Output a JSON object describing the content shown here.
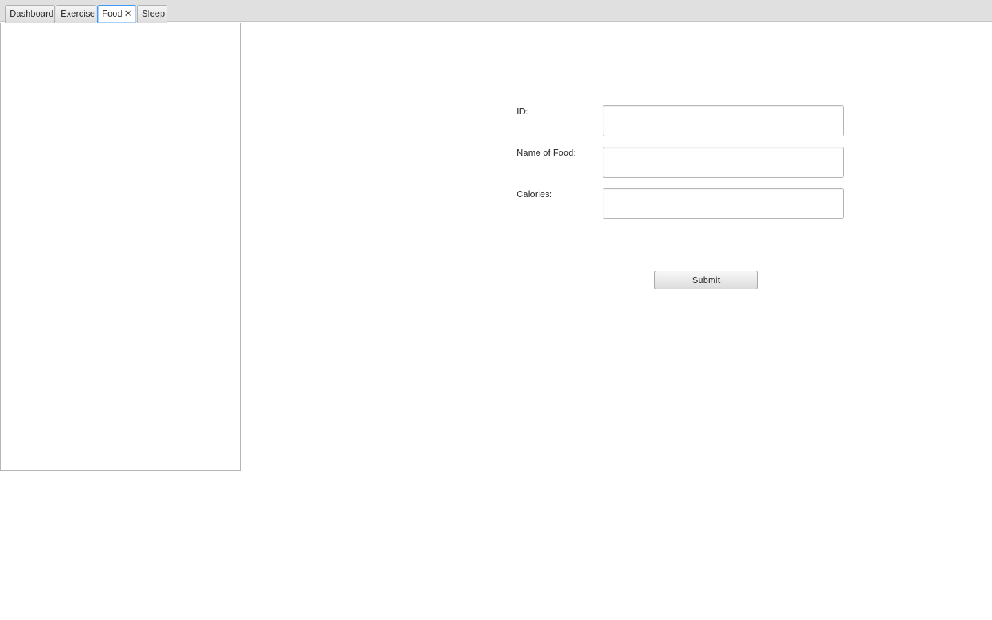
{
  "tabs": [
    {
      "label": "Dashboard",
      "selected": false,
      "closable": false
    },
    {
      "label": "Exercise",
      "selected": false,
      "closable": false
    },
    {
      "label": "Food",
      "selected": true,
      "closable": true,
      "close_glyph": "✕"
    },
    {
      "label": "Sleep",
      "selected": false,
      "closable": false
    }
  ],
  "form": {
    "id_label": "ID:",
    "id_value": "",
    "name_label": "Name of Food:",
    "name_value": "",
    "calories_label": "Calories:",
    "calories_value": "",
    "submit_label": "Submit"
  },
  "colors": {
    "selected_tab_border": "#3b99fc",
    "tabbar_background": "#e0e0e0"
  }
}
